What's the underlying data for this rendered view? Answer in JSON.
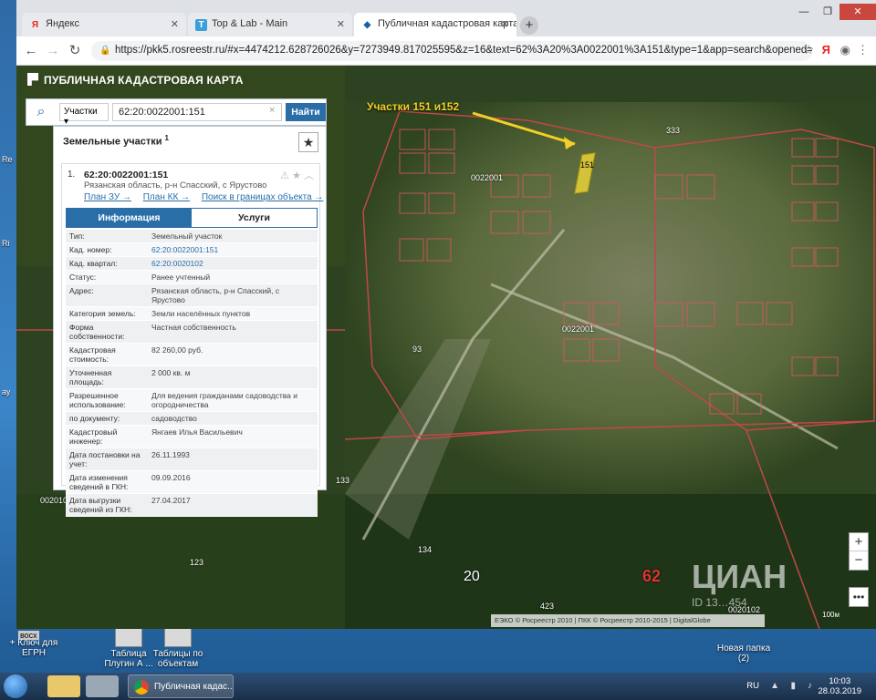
{
  "browser": {
    "tabs": [
      {
        "label": "Яндекс",
        "favicon": "Я"
      },
      {
        "label": "Top & Lab - Main",
        "favicon": "T"
      },
      {
        "label": "Публичная кадастровая карта",
        "favicon": "◆"
      }
    ],
    "url": "https://pkk5.rosreestr.ru/#x=4474212.628726026&y=7273949.817025595&z=16&text=62%3A20%3A0022001%3A151&type=1&app=search&opened=1",
    "yandex_icon": "Я"
  },
  "app": {
    "title": "ПУБЛИЧНАЯ КАДАСТРОВАЯ КАРТА",
    "search": {
      "type": "Участки",
      "value": "62:20:0022001:151",
      "clear": "×",
      "button": "Найти"
    },
    "results": {
      "title": "Земельные участки",
      "count": "1",
      "item": {
        "num": "1.",
        "cad_number": "62:20:0022001:151",
        "address": "Рязанская область, р-н Спасский, с Ярустово",
        "links": [
          "План ЗУ →",
          "План КК →",
          "Поиск в границах объекта →"
        ],
        "tabs": [
          "Информация",
          "Услуги"
        ],
        "attributes": [
          {
            "k": "Тип:",
            "v": "Земельный участок"
          },
          {
            "k": "Кад. номер:",
            "v": "62:20:0022001:151",
            "link": true
          },
          {
            "k": "Кад. квартал:",
            "v": "62:20:0020102",
            "link": true
          },
          {
            "k": "Статус:",
            "v": "Ранее учтенный"
          },
          {
            "k": "Адрес:",
            "v": "Рязанская область, р-н Спасский, с Ярустово"
          },
          {
            "k": "Категория земель:",
            "v": "Земли населённых пунктов"
          },
          {
            "k": "Форма собственности:",
            "v": "Частная собственность"
          },
          {
            "k": "Кадастровая стоимость:",
            "v": "82 260,00 руб."
          },
          {
            "k": "Уточненная площадь:",
            "v": "2 000 кв. м"
          },
          {
            "k": "Разрешенное использование:",
            "v": "Для ведения гражданами садоводства и огородничества"
          },
          {
            "k": "по документу:",
            "v": "садоводство"
          },
          {
            "k": "Кадастровый инженер:",
            "v": "Янгаев Илья Васильевич"
          },
          {
            "k": "Дата постановки на учет:",
            "v": "26.11.1993"
          },
          {
            "k": "Дата изменения сведений в ГКН:",
            "v": "09.09.2016"
          },
          {
            "k": "Дата выгрузки сведений из ГКН:",
            "v": "27.04.2017"
          }
        ]
      }
    },
    "callout": "Участки 151 и152",
    "map_labels": [
      "0022001",
      "0022001",
      "0020102",
      "0020102",
      "20",
      "62",
      "133",
      "134",
      "423",
      "93",
      "333",
      "123",
      "151"
    ],
    "zoom_in": "+",
    "zoom_out": "−",
    "more": "•••",
    "attribution": "ЕЭКО © Росреестр 2010 | ПКК © Росреестр 2010-2015 | DigitalGlobe",
    "scale": "100м",
    "watermark": "ЦИАН",
    "watermark_id": "ID 13…454"
  },
  "desktop": {
    "icons": [
      {
        "label": "+ Ключ для ЕГРН"
      },
      {
        "label": "Таблица Плугин А ..."
      },
      {
        "label": "Таблицы по объектам"
      },
      {
        "label": "Новая папка (2)"
      }
    ],
    "edge_labels": [
      "Re",
      "Ri",
      "ау",
      "восх"
    ]
  },
  "taskbar": {
    "task_label": "Публичная кадас...",
    "lang": "RU",
    "time": "10:03",
    "date": "28.03.2019"
  }
}
